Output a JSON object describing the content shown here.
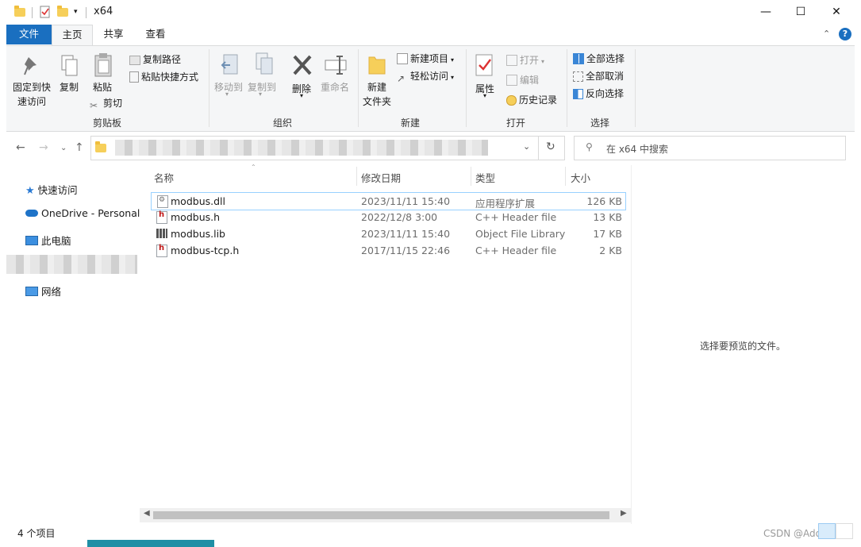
{
  "window": {
    "title": "x64",
    "controls": {
      "minimize": "—",
      "maximize": "☐",
      "close": "✕"
    }
  },
  "tabs": {
    "file": "文件",
    "home": "主页",
    "share": "共享",
    "view": "查看"
  },
  "ribbon": {
    "clipboard": {
      "pin": "固定到快\n速访问",
      "pin_line1": "固定到快",
      "pin_line2": "速访问",
      "copy": "复制",
      "paste": "粘贴",
      "copy_path": "复制路径",
      "paste_shortcut": "粘贴快捷方式",
      "cut": "剪切",
      "group": "剪贴板"
    },
    "organize": {
      "move_to": "移动到",
      "copy_to": "复制到",
      "delete": "删除",
      "rename": "重命名",
      "group": "组织"
    },
    "new": {
      "new_folder_line1": "新建",
      "new_folder_line2": "文件夹",
      "new_item": "新建项目",
      "easy_access": "轻松访问",
      "group": "新建"
    },
    "open": {
      "properties": "属性",
      "open": "打开",
      "edit": "编辑",
      "history": "历史记录",
      "group": "打开"
    },
    "select": {
      "select_all": "全部选择",
      "select_none": "全部取消",
      "invert": "反向选择",
      "group": "选择"
    }
  },
  "address": {
    "search_placeholder": "在 x64 中搜索"
  },
  "nav_pane": {
    "items": [
      "快速访问",
      "OneDrive - Personal",
      "此电脑",
      "网络"
    ]
  },
  "columns": {
    "name": "名称",
    "date": "修改日期",
    "type": "类型",
    "size": "大小"
  },
  "files": [
    {
      "name": "modbus.dll",
      "date": "2023/11/11 15:40",
      "type": "应用程序扩展",
      "size": "126 KB",
      "icon": "dll-file-icon"
    },
    {
      "name": "modbus.h",
      "date": "2022/12/8 3:00",
      "type": "C++ Header file",
      "size": "13 KB",
      "icon": "header-file-icon"
    },
    {
      "name": "modbus.lib",
      "date": "2023/11/11 15:40",
      "type": "Object File Library",
      "size": "17 KB",
      "icon": "lib-file-icon"
    },
    {
      "name": "modbus-tcp.h",
      "date": "2017/11/15 22:46",
      "type": "C++ Header file",
      "size": "2 KB",
      "icon": "header-file-icon"
    }
  ],
  "preview": {
    "empty_text": "选择要预览的文件。"
  },
  "status": {
    "item_count": "4 个项目"
  },
  "watermark": "CSDN @Adoranya",
  "colors": {
    "accent": "#1a6fc0",
    "selection_border": "#99d1ff",
    "ribbon_bg": "#f5f6f7"
  }
}
